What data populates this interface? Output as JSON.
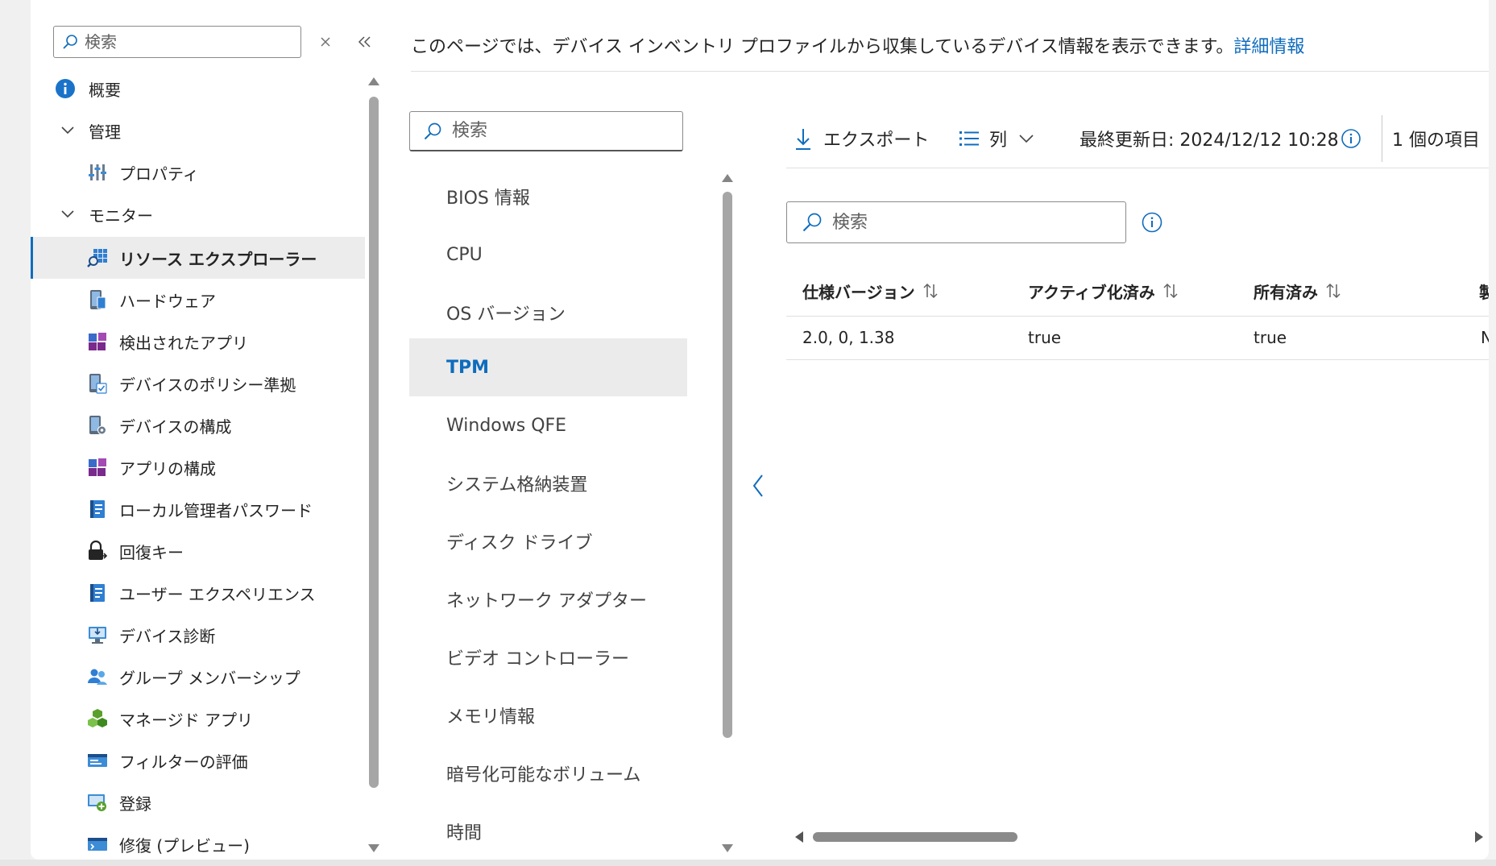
{
  "nav": {
    "search_placeholder": "検索",
    "items": [
      {
        "label": "概要",
        "icon": "info-icon"
      },
      {
        "label": "管理",
        "icon": "chevron-down-icon"
      },
      {
        "label": "プロパティ",
        "icon": "properties-icon"
      },
      {
        "label": "モニター",
        "icon": "chevron-down-icon"
      },
      {
        "label": "リソース エクスプローラー",
        "icon": "resource-explorer-icon"
      },
      {
        "label": "ハードウェア",
        "icon": "hardware-icon"
      },
      {
        "label": "検出されたアプリ",
        "icon": "discovered-apps-icon"
      },
      {
        "label": "デバイスのポリシー準拠",
        "icon": "device-compliance-icon"
      },
      {
        "label": "デバイスの構成",
        "icon": "device-configuration-icon"
      },
      {
        "label": "アプリの構成",
        "icon": "app-configuration-icon"
      },
      {
        "label": "ローカル管理者パスワード",
        "icon": "local-admin-password-icon"
      },
      {
        "label": "回復キー",
        "icon": "recovery-key-icon"
      },
      {
        "label": "ユーザー エクスペリエンス",
        "icon": "user-experience-icon"
      },
      {
        "label": "デバイス診断",
        "icon": "device-diagnostics-icon"
      },
      {
        "label": "グループ メンバーシップ",
        "icon": "group-membership-icon"
      },
      {
        "label": "マネージド アプリ",
        "icon": "managed-apps-icon"
      },
      {
        "label": "フィルターの評価",
        "icon": "filter-evaluation-icon"
      },
      {
        "label": "登録",
        "icon": "enrollment-icon"
      },
      {
        "label": "修復 (プレビュー)",
        "icon": "remediation-icon"
      }
    ],
    "active_index": 4
  },
  "header": {
    "description": "このページでは、デバイス インベントリ プロファイルから収集しているデバイス情報を表示できます。",
    "link_text": "詳細情報"
  },
  "categories": {
    "search_placeholder": "検索",
    "items": [
      "BIOS 情報",
      "CPU",
      "OS バージョン",
      "TPM",
      "Windows QFE",
      "システム格納装置",
      "ディスク ドライブ",
      "ネットワーク アダプター",
      "ビデオ コントローラー",
      "メモリ情報",
      "暗号化可能なボリューム",
      "時間"
    ],
    "active_index": 3
  },
  "toolbar": {
    "export_label": "エクスポート",
    "columns_label": "列",
    "last_updated": "最終更新日: 2024/12/12 10:28",
    "item_count": "1 個の項目"
  },
  "grid": {
    "search_placeholder": "検索",
    "columns": [
      "仕様バージョン",
      "アクティブ化済み",
      "所有済み",
      "製"
    ],
    "rows": [
      [
        "2.0, 0, 1.38",
        "true",
        "true",
        "N"
      ]
    ]
  },
  "colors": {
    "accent": "#0f6cbd",
    "selected_bg": "#ebebeb",
    "text": "#242424"
  }
}
